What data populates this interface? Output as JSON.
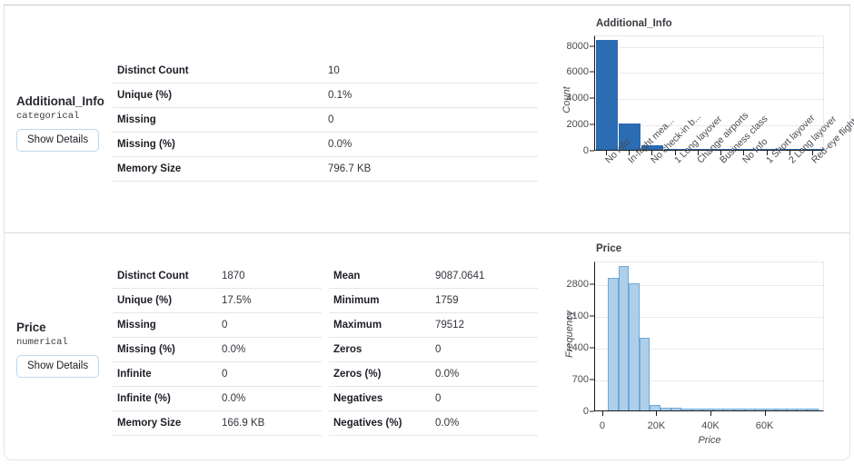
{
  "variables": [
    {
      "name": "Additional_Info",
      "type": "categorical",
      "button_label": "Show Details",
      "stats_left": [
        {
          "key": "Distinct Count",
          "value": "10"
        },
        {
          "key": "Unique (%)",
          "value": "0.1%"
        },
        {
          "key": "Missing",
          "value": "0"
        },
        {
          "key": "Missing (%)",
          "value": "0.0%"
        },
        {
          "key": "Memory Size",
          "value": "796.7 KB"
        }
      ],
      "stats_right": []
    },
    {
      "name": "Price",
      "type": "numerical",
      "button_label": "Show Details",
      "stats_left": [
        {
          "key": "Distinct Count",
          "value": "1870"
        },
        {
          "key": "Unique (%)",
          "value": "17.5%"
        },
        {
          "key": "Missing",
          "value": "0"
        },
        {
          "key": "Missing (%)",
          "value": "0.0%"
        },
        {
          "key": "Infinite",
          "value": "0"
        },
        {
          "key": "Infinite (%)",
          "value": "0.0%"
        },
        {
          "key": "Memory Size",
          "value": "166.9 KB"
        }
      ],
      "stats_right": [
        {
          "key": "Mean",
          "value": "9087.0641"
        },
        {
          "key": "Minimum",
          "value": "1759"
        },
        {
          "key": "Maximum",
          "value": "79512"
        },
        {
          "key": "Zeros",
          "value": "0"
        },
        {
          "key": "Zeros (%)",
          "value": "0.0%"
        },
        {
          "key": "Negatives",
          "value": "0"
        },
        {
          "key": "Negatives (%)",
          "value": "0.0%"
        }
      ]
    }
  ],
  "colors": {
    "bar_fill": "#2b6cb2",
    "hist_fill": "#aecfea",
    "hist_edge": "#6fa8d8",
    "button_border": "#bcd7ee",
    "grid": "#eaeaee",
    "axis": "#1a1a1a"
  },
  "chart_data": [
    {
      "type": "bar",
      "title": "Additional_Info",
      "xlabel": "",
      "ylabel": "Count",
      "categories": [
        "No info",
        "In-flight mea...",
        "No check-in b...",
        "1 Long layover",
        "Change airports",
        "Business class",
        "No Info",
        "1 Short layover",
        "2 Long layover",
        "Red-eye flight"
      ],
      "values": [
        8400,
        1980,
        330,
        25,
        22,
        20,
        18,
        12,
        10,
        8
      ],
      "yticks": [
        0,
        2000,
        4000,
        6000,
        8000
      ],
      "ylim": [
        0,
        8800
      ],
      "grid": true,
      "legend": "none"
    },
    {
      "type": "bar",
      "subtype": "histogram",
      "title": "Price",
      "xlabel": "Price",
      "ylabel": "Frequency",
      "bin_edges": [
        1759,
        5647,
        9535,
        13423,
        17311,
        21199,
        25087,
        28975,
        32863,
        36751,
        40639,
        44527,
        48415,
        52303,
        56191,
        60079,
        63967,
        67855,
        71743,
        75627,
        79512
      ],
      "values": [
        2920,
        3190,
        2800,
        1600,
        130,
        60,
        70,
        12,
        8,
        6,
        5,
        4,
        4,
        3,
        3,
        2,
        2,
        2,
        2,
        2
      ],
      "yticks": [
        0,
        700,
        1400,
        2100,
        2800
      ],
      "ylim": [
        0,
        3300
      ],
      "xticks": [
        0,
        20000,
        40000,
        60000
      ],
      "xtick_labels": [
        "0",
        "20K",
        "40K",
        "60K"
      ],
      "xlim": [
        -3000,
        82000
      ],
      "grid": true,
      "legend": "none"
    }
  ]
}
